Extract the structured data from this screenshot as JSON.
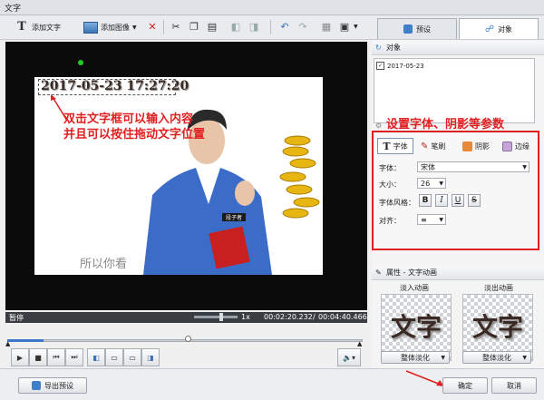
{
  "window": {
    "title": "文字"
  },
  "toolbar": {
    "add_text_label": "添加文字",
    "add_image_label": "添加图像"
  },
  "tabs": [
    {
      "label": "预设"
    },
    {
      "label": "对象"
    }
  ],
  "video": {
    "overlay_text": "2017-05-23 17:27:20",
    "caption_text": "所以你看",
    "badge_text": "段子者"
  },
  "annotations": {
    "note1_line1": "双击文字框可以输入内容",
    "note1_line2": "并且可以按住拖动文字位置",
    "note2": "设置字体、阴影等参数"
  },
  "player": {
    "status": "暂停",
    "zoom": "1x",
    "time_current": "00:02:20.232",
    "time_total": "00:04:40.466"
  },
  "objects_panel": {
    "header": "对象",
    "items": [
      "2017-05-23"
    ]
  },
  "properties": {
    "tabs": [
      {
        "label": "字体"
      },
      {
        "label": "笔刷"
      },
      {
        "label": "阴影"
      },
      {
        "label": "边缘"
      }
    ],
    "font_label": "字体：",
    "font_value": "宋体",
    "size_label": "大小：",
    "size_value": "26",
    "style_label": "字体风格：",
    "style_buttons": [
      "B",
      "I",
      "U",
      "S"
    ],
    "align_label": "对齐：",
    "align_value": "≡"
  },
  "animation": {
    "header": "属性 - 文字动画",
    "fade_in_label": "淡入动画",
    "fade_out_label": "淡出动画",
    "sample_text": "文字",
    "fade_in_select": "整体淡化",
    "fade_out_select": "整体淡化"
  },
  "footer": {
    "export_preset_label": "导出预设",
    "ok_label": "确定",
    "cancel_label": "取消"
  },
  "colors": {
    "accent": "#2f6fbf",
    "annotation": "#e02020",
    "selected_tab": "#ffffff"
  }
}
